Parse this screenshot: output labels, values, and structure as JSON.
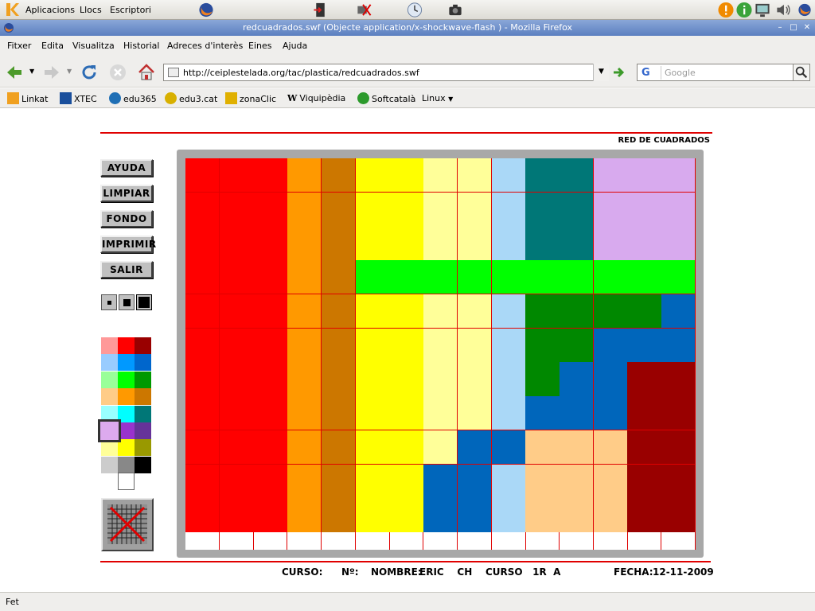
{
  "panel": {
    "menu_apps": "Aplicacions",
    "menu_places": "Llocs",
    "menu_desktop": "Escriptori"
  },
  "window": {
    "title": "redcuadrados.swf (Objecte application/x-shockwave-flash ) - Mozilla Firefox"
  },
  "menubar": [
    "Fitxer",
    "Edita",
    "Visualitza",
    "Historial",
    "Adreces d'interès",
    "Eines",
    "Ajuda"
  ],
  "navigation": {
    "url": "http://ceiplestelada.org/tac/plastica/redcuadrados.swf",
    "search_placeholder": "Google",
    "search_engine": "G"
  },
  "bookmarks": [
    {
      "label": "Linkat",
      "icon": "linkat-icon",
      "color": "#f0a020"
    },
    {
      "label": "XTEC",
      "icon": "xtec-icon",
      "color": "#1a4f9c"
    },
    {
      "label": "edu365",
      "icon": "edu365-icon",
      "color": "#1f6fb5"
    },
    {
      "label": "edu3.cat",
      "icon": "edu3-icon",
      "color": "#d8b000"
    },
    {
      "label": "zonaClic",
      "icon": "zonaclic-icon",
      "color": "#e0b000"
    },
    {
      "label": "Viquipèdia",
      "icon": "wikipedia-icon",
      "color": "#333333"
    },
    {
      "label": "Softcatalà",
      "icon": "softcatala-icon",
      "color": "#2c9a2c"
    },
    {
      "label": "Linux",
      "icon": "dropdown-icon",
      "color": "#555555"
    }
  ],
  "app": {
    "title": "RED DE CUADRADOS",
    "buttons": [
      "AYUDA",
      "LIMPIAR",
      "FONDO",
      "IMPRIMIR",
      "SALIR"
    ],
    "brush_sizes": [
      "small",
      "medium",
      "large"
    ],
    "selected_brush": "large",
    "palette": [
      [
        "#ff9999",
        "#ff0000",
        "#990000"
      ],
      [
        "#99ccff",
        "#0099ff",
        "#0066cc"
      ],
      [
        "#99ff99",
        "#00ff00",
        "#009900"
      ],
      [
        "#ffcc88",
        "#ff9900",
        "#cc7700"
      ],
      [
        "#99ffff",
        "#00ffff",
        "#007777"
      ],
      [
        "#ddaaee",
        "#9933cc",
        "#663399"
      ],
      [
        "#ffff99",
        "#ffff00",
        "#999900"
      ],
      [
        "#cccccc",
        "#888888",
        "#000000"
      ]
    ],
    "selected_color": "#ddaaee",
    "grid_columns": 15,
    "grid_rows": 11,
    "grid": [
      [
        "R",
        "R",
        "R",
        "O",
        "B",
        "Y",
        "Y",
        "LY",
        "LY",
        "LB",
        "T",
        "T",
        "LV",
        "LV",
        "LV"
      ],
      [
        "R",
        "R",
        "R",
        "O",
        "B",
        "Y",
        "Y",
        "LY",
        "LY",
        "LB",
        "T",
        "T",
        "LV",
        "LV",
        "LV"
      ],
      [
        "R",
        "R",
        "R",
        "O",
        "B",
        "Y",
        "Y",
        "LY",
        "LY",
        "LB",
        "T",
        "T",
        "LV",
        "LV",
        "LV"
      ],
      [
        "R",
        "R",
        "R",
        "O",
        "B",
        "G",
        "G",
        "G",
        "G",
        "G",
        "G",
        "G",
        "G",
        "G",
        "G"
      ],
      [
        "R",
        "R",
        "R",
        "O",
        "B",
        "Y",
        "Y",
        "LY",
        "LY",
        "LB",
        "DG",
        "DG",
        "DG",
        "DG",
        "BL"
      ],
      [
        "R",
        "R",
        "R",
        "O",
        "B",
        "Y",
        "Y",
        "LY",
        "LY",
        "LB",
        "DG",
        "DG",
        "BL",
        "BL",
        "BL"
      ],
      [
        "R",
        "R",
        "R",
        "O",
        "B",
        "Y",
        "Y",
        "LY",
        "LY",
        "LB",
        "DG",
        "BL",
        "BL",
        "DR",
        "DR"
      ],
      [
        "R",
        "R",
        "R",
        "O",
        "B",
        "Y",
        "Y",
        "LY",
        "LY",
        "LB",
        "BL",
        "BL",
        "BL",
        "DR",
        "DR"
      ],
      [
        "R",
        "R",
        "R",
        "O",
        "B",
        "Y",
        "Y",
        "LY",
        "BL",
        "BL",
        "PE",
        "PE",
        "PE",
        "DR",
        "DR"
      ],
      [
        "R",
        "R",
        "R",
        "O",
        "B",
        "Y",
        "Y",
        "BL",
        "BL",
        "LB",
        "PE",
        "PE",
        "PE",
        "DR",
        "DR"
      ],
      [
        "R",
        "R",
        "R",
        "O",
        "B",
        "Y",
        "Y",
        "BL",
        "BL",
        "LB",
        "PE",
        "PE",
        "PE",
        "DR",
        "DR"
      ]
    ],
    "colors": {
      "R": "#ff0000",
      "O": "#ff9900",
      "B": "#cc7700",
      "Y": "#ffff00",
      "LY": "#ffff99",
      "LB": "#aad8f7",
      "T": "#007777",
      "LV": "#d8aaee",
      "G": "#00ff00",
      "DG": "#008800",
      "BL": "#0066bb",
      "DR": "#990000",
      "PE": "#ffcc88"
    },
    "footer": {
      "curso_label": "CURSO:",
      "num_label": "Nº:",
      "nombre_label": "NOMBRE:",
      "nombre_value": "ERIC    CH    CURSO   1R  A",
      "fecha_label": "FECHA:",
      "fecha_value": "12-11-2009"
    }
  },
  "status": {
    "text": "Fet"
  }
}
